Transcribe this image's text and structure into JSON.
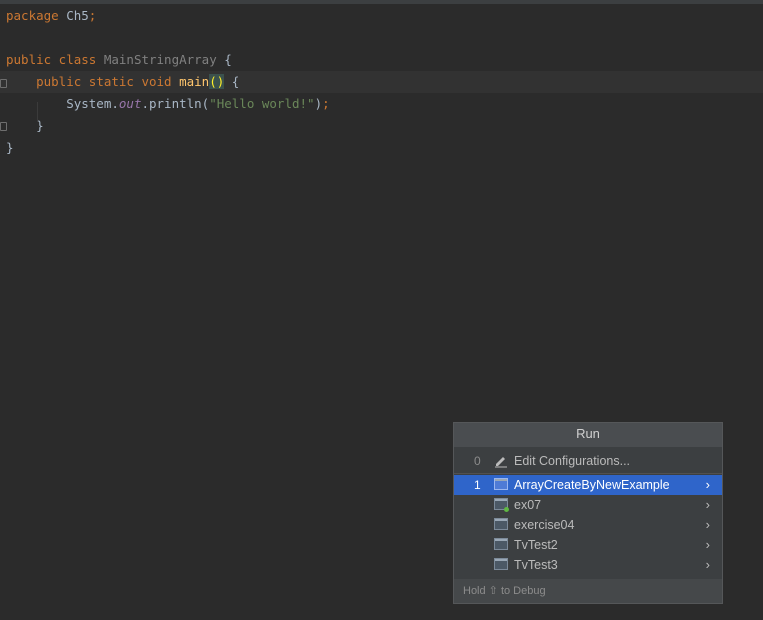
{
  "editor": {
    "lines": [
      {
        "tokens": [
          {
            "t": "package ",
            "c": "kw"
          },
          {
            "t": "Ch5",
            "c": "pl"
          },
          {
            "t": ";",
            "c": "kw"
          }
        ]
      },
      {
        "tokens": []
      },
      {
        "tokens": [
          {
            "t": "public class ",
            "c": "kw"
          },
          {
            "t": "MainStringArray",
            "c": "cls"
          },
          {
            "t": " {",
            "c": "pl"
          }
        ]
      },
      {
        "tokens": [
          {
            "t": "    ",
            "c": "pl"
          },
          {
            "t": "public static void ",
            "c": "kw"
          },
          {
            "t": "main",
            "c": "fn"
          },
          {
            "t": "()",
            "c": "ph"
          },
          {
            "t": " {",
            "c": "pl"
          }
        ],
        "current": true
      },
      {
        "tokens": [
          {
            "t": "        System.",
            "c": "pl"
          },
          {
            "t": "out",
            "c": "it"
          },
          {
            "t": ".println(",
            "c": "pl"
          },
          {
            "t": "\"Hello world!\"",
            "c": "str"
          },
          {
            "t": ")",
            "c": "pl"
          },
          {
            "t": ";",
            "c": "kw"
          }
        ]
      },
      {
        "tokens": [
          {
            "t": "    }",
            "c": "pl"
          }
        ]
      },
      {
        "tokens": [
          {
            "t": "}",
            "c": "pl"
          }
        ]
      }
    ]
  },
  "popup": {
    "title": "Run",
    "edit_item": {
      "number": "0",
      "label": "Edit Configurations..."
    },
    "configs": [
      {
        "number": "1",
        "label": "ArrayCreateByNewExample",
        "selected": true,
        "running": false
      },
      {
        "number": "",
        "label": "ex07",
        "selected": false,
        "running": true
      },
      {
        "number": "",
        "label": "exercise04",
        "selected": false,
        "running": false
      },
      {
        "number": "",
        "label": "TvTest2",
        "selected": false,
        "running": false
      },
      {
        "number": "",
        "label": "TvTest3",
        "selected": false,
        "running": false
      }
    ],
    "submenu_glyph": "›",
    "footer": "Hold ⇧ to Debug"
  }
}
